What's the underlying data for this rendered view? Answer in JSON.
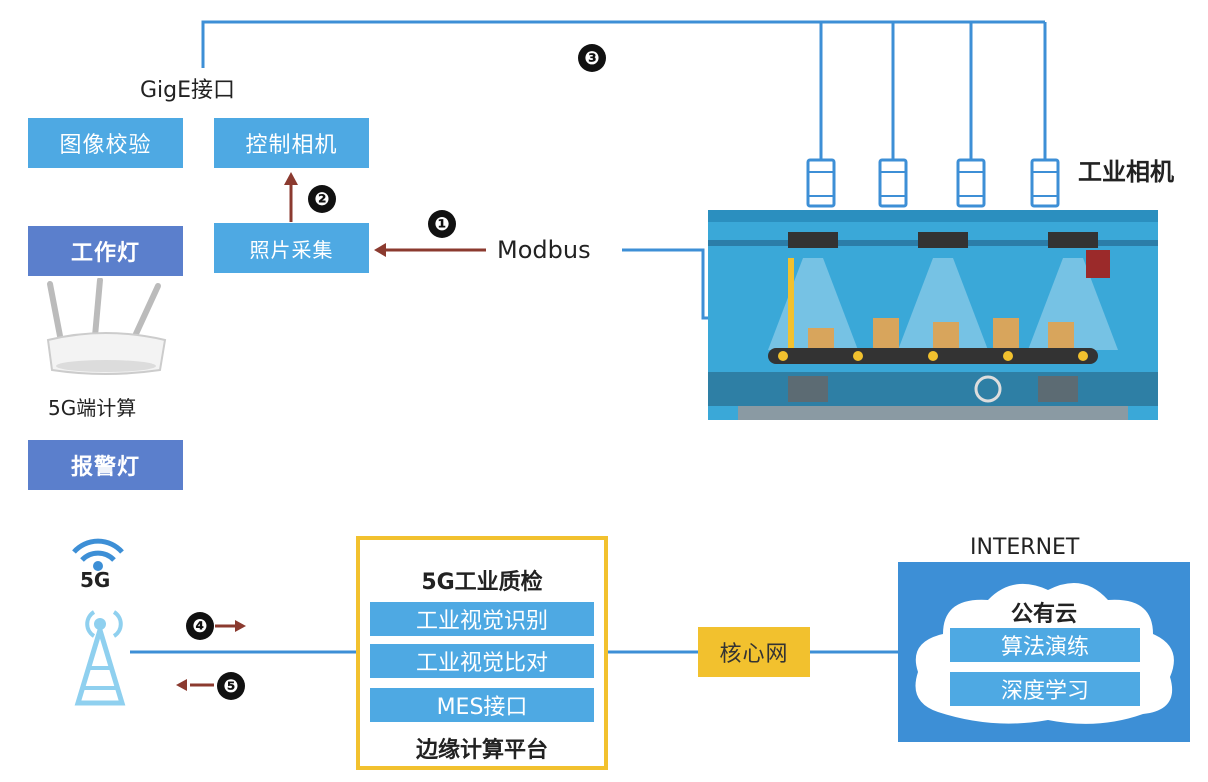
{
  "left": {
    "gige_label": "GigE接口",
    "image_check": "图像校验",
    "control_camera": "控制相机",
    "photo_capture": "照片采集",
    "work_light": "工作灯",
    "edge_5g_compute": "5G端计算",
    "alarm_light": "报警灯",
    "modbus": "Modbus"
  },
  "markers": {
    "m1": "❶",
    "m2": "❷",
    "m3": "❸",
    "m4": "❹",
    "m5": "❺"
  },
  "camera": {
    "label": "工业相机"
  },
  "signal": {
    "label": "5G"
  },
  "edge_platform": {
    "title": "5G工业质检",
    "items": [
      "工业视觉识别",
      "工业视觉比对",
      "MES接口"
    ],
    "footer": "边缘计算平台"
  },
  "core_net": {
    "label": "核心网"
  },
  "internet": {
    "label": "INTERNET",
    "cloud_title": "公有云",
    "items": [
      "算法演练",
      "深度学习"
    ]
  },
  "colors": {
    "light_blue": "#4ea9e3",
    "dark_blue": "#5b7fcc",
    "arrow_red": "#8b3a2f",
    "line_blue": "#3d8fd6",
    "yellow": "#f2c12e"
  }
}
